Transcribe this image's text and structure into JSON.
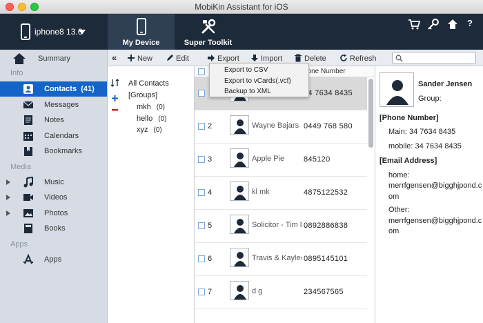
{
  "window": {
    "title": "MobiKin Assistant for iOS"
  },
  "header": {
    "device_name": "iphone8 13.6",
    "tabs": [
      {
        "label": "My Device"
      },
      {
        "label": "Super Toolkit"
      }
    ],
    "help_label": "?"
  },
  "sidebar": {
    "summary": "Summary",
    "sections": {
      "info": "Info",
      "media": "Media",
      "apps": "Apps"
    },
    "contacts": {
      "label": "Contacts",
      "count": "(41)"
    },
    "messages": "Messages",
    "notes": "Notes",
    "calendars": "Calendars",
    "bookmarks": "Bookmarks",
    "music": "Music",
    "videos": "Videos",
    "photos": "Photos",
    "books": "Books",
    "apps": "Apps"
  },
  "toolbar": {
    "collapse": "«",
    "new": "New",
    "edit": "Edit",
    "export": "Export",
    "import": "Import",
    "delete": "Delete",
    "refresh": "Refresh",
    "search_placeholder": ""
  },
  "export_menu": [
    "Export to CSV",
    "Export to vCards(.vcf)",
    "Backup to XML"
  ],
  "groups": {
    "all": "All Contacts",
    "groups_label": "[Groups]",
    "items": [
      {
        "name": "mkh",
        "count": "(0)"
      },
      {
        "name": "hello",
        "count": "(0)"
      },
      {
        "name": "xyz",
        "count": "(0)"
      }
    ]
  },
  "list": {
    "phone_header": "hone Number",
    "rows": [
      {
        "num": "",
        "name": "",
        "phone": "34 7634 8435"
      },
      {
        "num": "2",
        "name": "Wayne Bajars",
        "phone": "0449 768 580"
      },
      {
        "num": "3",
        "name": "Apple Pie",
        "phone": "845120"
      },
      {
        "num": "4",
        "name": "kl mk",
        "phone": "4875122532"
      },
      {
        "num": "5",
        "name": "Solicitor - Tim I",
        "phone": "0892886838"
      },
      {
        "num": "6",
        "name": "Travis & Kaylee",
        "phone": "0895145101"
      },
      {
        "num": "7",
        "name": "d g",
        "phone": "234567565"
      }
    ]
  },
  "details": {
    "name": "Sander Jensen",
    "group_label": "Group:",
    "phone_section": "[Phone Number]",
    "main": "Main:  34 7634 8435",
    "mobile": "mobile:  34 7634 8435",
    "email_section": "[Email Address]",
    "home_label": "home:",
    "home_line1": "merrfgensen@bigghjpond.c",
    "home_line2": "om",
    "other_label": "Other:",
    "other_line1": "merrfgensen@bigghjpond.c",
    "other_line2": "om"
  },
  "colors": {
    "header": "#1d2a3a",
    "active_tab": "#2f3f54",
    "selection": "#1565c8"
  }
}
